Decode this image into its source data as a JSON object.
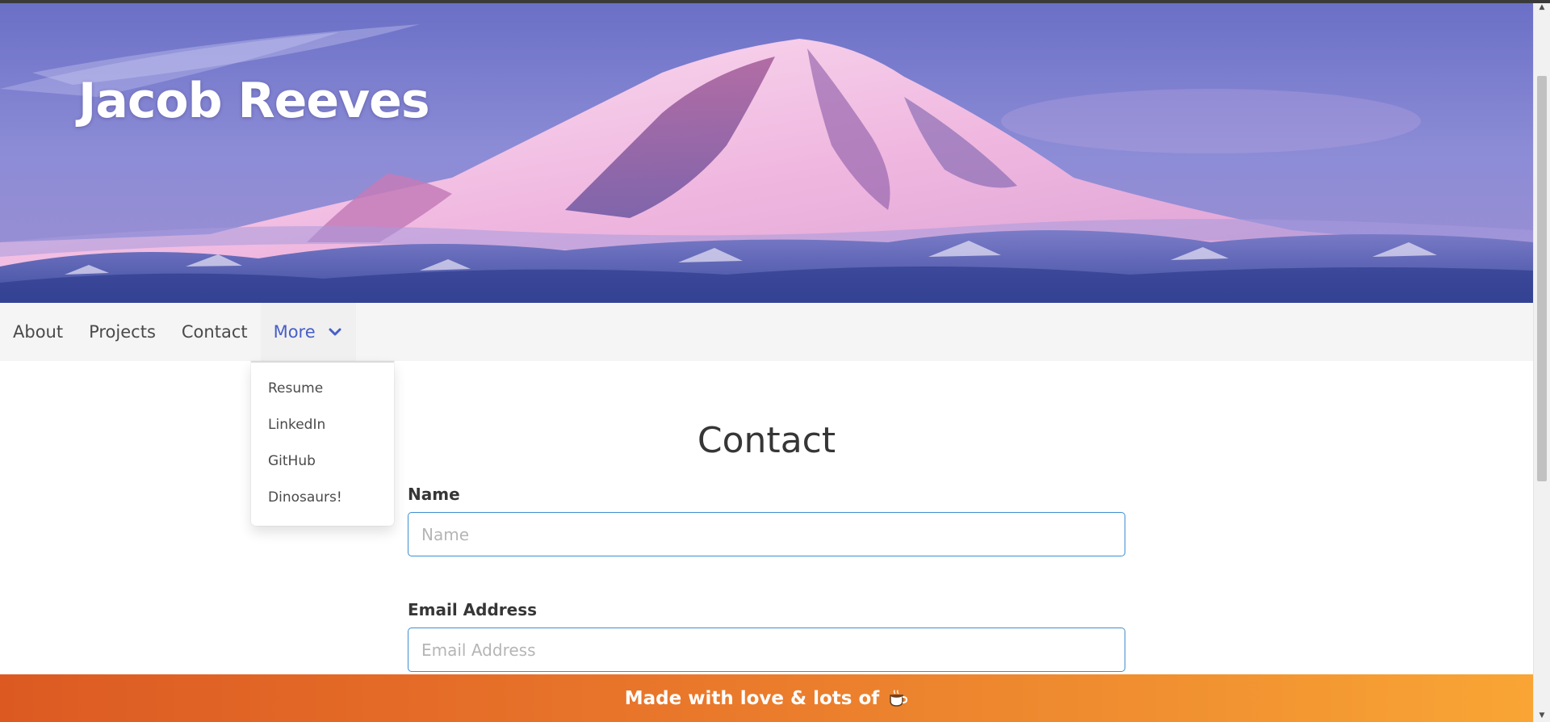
{
  "hero": {
    "title": "Jacob Reeves"
  },
  "nav": {
    "items": [
      {
        "label": "About"
      },
      {
        "label": "Projects"
      },
      {
        "label": "Contact"
      }
    ],
    "more_label": "More",
    "more_icon": "chevron-down-icon"
  },
  "dropdown": {
    "items": [
      {
        "label": "Resume"
      },
      {
        "label": "LinkedIn"
      },
      {
        "label": "GitHub"
      },
      {
        "label": "Dinosaurs!"
      }
    ]
  },
  "contact": {
    "title": "Contact",
    "name_label": "Name",
    "name_placeholder": "Name",
    "email_label": "Email Address",
    "email_placeholder": "Email Address"
  },
  "footer": {
    "text": "Made with love & lots of",
    "icon": "coffee-icon"
  },
  "colors": {
    "accent": "#485fc7",
    "input_border": "#3e8ed0",
    "footer_start": "#dc5a22",
    "footer_end": "#f9a535",
    "navbar_bg": "#f5f5f5"
  }
}
